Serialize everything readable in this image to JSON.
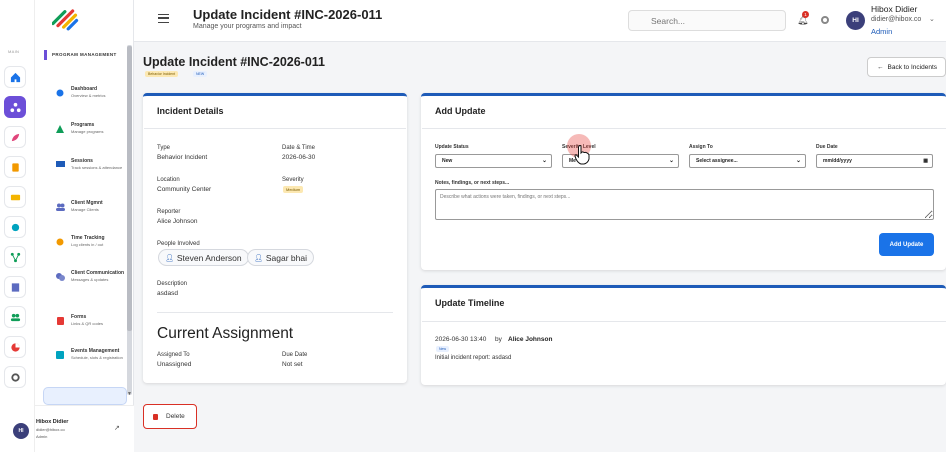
{
  "header": {
    "title": "Update Incident #INC-2026-011",
    "subtitle": "Manage your programs and impact",
    "search_placeholder": "Search...",
    "notif_count": "1",
    "user_initials": "HI",
    "user_name": "Hibox Didier",
    "user_email": "didier@hibox.co",
    "user_role": "Admin"
  },
  "rail": {
    "label": "MAIN"
  },
  "sidebar": {
    "section": "PROGRAM MANAGEMENT",
    "items": [
      {
        "title": "Dashboard",
        "desc": "Overview & metrics"
      },
      {
        "title": "Programs",
        "desc": "Manage programs"
      },
      {
        "title": "Sessions",
        "desc": "Track sessions & attendance"
      },
      {
        "title": "Client Mgmnt",
        "desc": "Manage Clients"
      },
      {
        "title": "Time Tracking",
        "desc": "Log clients in / out"
      },
      {
        "title": "Client Communication",
        "desc": "Messages & updates"
      },
      {
        "title": "Forms",
        "desc": "Links & QR codes"
      },
      {
        "title": "Events Management",
        "desc": "Schedule, slots & registration"
      }
    ],
    "footer_initials": "HI",
    "footer_name": "Hibox Didier",
    "footer_email": "didier@hibox.co",
    "footer_role": "Admin"
  },
  "page": {
    "title": "Update Incident #INC-2026-011",
    "badge_type": "Behavior Incident",
    "badge_status": "NEW",
    "back_label": "Back to Incidents",
    "delete_label": "Delete"
  },
  "details": {
    "heading": "Incident Details",
    "type_label": "Type",
    "type_value": "Behavior Incident",
    "datetime_label": "Date & Time",
    "datetime_value": "2026-06-30",
    "location_label": "Location",
    "location_value": "Community Center",
    "severity_label": "Severity",
    "severity_value": "Medium",
    "reporter_label": "Reporter",
    "reporter_value": "Alice Johnson",
    "people_label": "People Involved",
    "people": [
      "Steven Anderson",
      "Sagar bhai"
    ],
    "description_label": "Description",
    "description_value": "asdasd"
  },
  "assignment": {
    "heading": "Current Assignment",
    "assigned_label": "Assigned To",
    "assigned_value": "Unassigned",
    "due_label": "Due Date",
    "due_value": "Not set"
  },
  "add_update": {
    "heading": "Add Update",
    "status_label": "Update Status",
    "status_value": "New",
    "severity_label": "Severity Level",
    "severity_value": "Me",
    "assign_label": "Assign To",
    "assign_value": "Select assignee...",
    "due_label": "Due Date",
    "due_value": "mm/dd/yyyy",
    "notes_label": "Notes, findings, or next steps...",
    "notes_placeholder": "Describe what actions were taken, findings, or next steps...",
    "submit_label": "Add Update"
  },
  "timeline": {
    "heading": "Update Timeline",
    "entries": [
      {
        "date": "2026-06-30 13:40",
        "by": "by",
        "author": "Alice Johnson",
        "status": "New",
        "text": "Initial incident report: asdasd"
      }
    ]
  },
  "colors": {
    "accent": "#1a73e8",
    "brand": "#6c4fd8",
    "danger": "#d93025",
    "card_top": "#1e5bb8"
  }
}
